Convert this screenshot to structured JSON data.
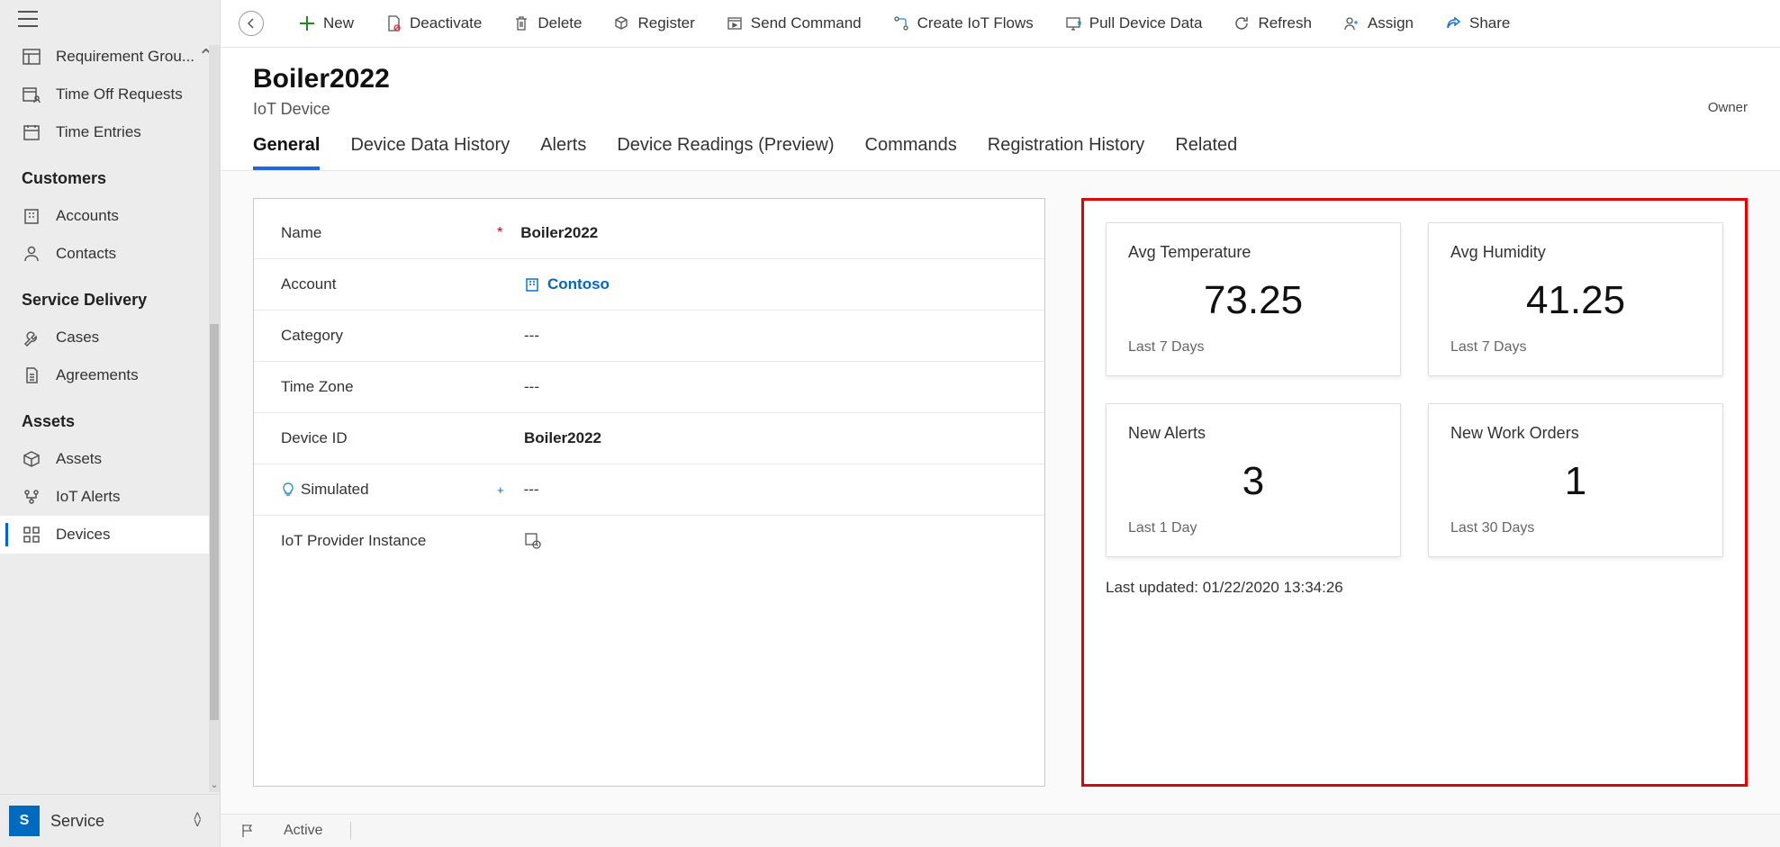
{
  "sidebar": {
    "items_top": [
      {
        "label": "Requirement Grou...",
        "icon": "layout"
      },
      {
        "label": "Time Off Requests",
        "icon": "calendar-person"
      },
      {
        "label": "Time Entries",
        "icon": "calendar"
      }
    ],
    "sections": [
      {
        "title": "Customers",
        "items": [
          {
            "label": "Accounts",
            "icon": "building"
          },
          {
            "label": "Contacts",
            "icon": "person"
          }
        ]
      },
      {
        "title": "Service Delivery",
        "items": [
          {
            "label": "Cases",
            "icon": "wrench"
          },
          {
            "label": "Agreements",
            "icon": "document"
          }
        ]
      },
      {
        "title": "Assets",
        "items": [
          {
            "label": "Assets",
            "icon": "cube"
          },
          {
            "label": "IoT Alerts",
            "icon": "alert-net"
          },
          {
            "label": "Devices",
            "icon": "grid",
            "active": true
          }
        ]
      }
    ],
    "footer": {
      "badge": "S",
      "label": "Service"
    }
  },
  "commands": [
    {
      "label": "New",
      "icon": "plus",
      "color": "#1a8f1a"
    },
    {
      "label": "Deactivate",
      "icon": "doc-cancel"
    },
    {
      "label": "Delete",
      "icon": "trash"
    },
    {
      "label": "Register",
      "icon": "cube-out"
    },
    {
      "label": "Send Command",
      "icon": "window-play"
    },
    {
      "label": "Create IoT Flows",
      "icon": "flow"
    },
    {
      "label": "Pull Device Data",
      "icon": "monitor-down"
    },
    {
      "label": "Refresh",
      "icon": "refresh"
    },
    {
      "label": "Assign",
      "icon": "person-plus"
    },
    {
      "label": "Share",
      "icon": "share",
      "color": "#1a6fd6"
    }
  ],
  "header": {
    "title": "Boiler2022",
    "subtitle": "IoT Device",
    "owner_label": "Owner"
  },
  "tabs": [
    {
      "label": "General",
      "active": true
    },
    {
      "label": "Device Data History"
    },
    {
      "label": "Alerts"
    },
    {
      "label": "Device Readings (Preview)"
    },
    {
      "label": "Commands"
    },
    {
      "label": "Registration History"
    },
    {
      "label": "Related"
    }
  ],
  "form": {
    "rows": [
      {
        "label": "Name",
        "required": true,
        "value": "Boiler2022",
        "type": "text"
      },
      {
        "label": "Account",
        "value": "Contoso",
        "type": "link"
      },
      {
        "label": "Category",
        "value": "---",
        "type": "empty"
      },
      {
        "label": "Time Zone",
        "value": "---",
        "type": "empty"
      },
      {
        "label": "Device ID",
        "value": "Boiler2022",
        "type": "text"
      },
      {
        "label": "Simulated",
        "value": "---",
        "type": "empty",
        "hint": true,
        "plus": true
      },
      {
        "label": "IoT Provider Instance",
        "value": "",
        "type": "iconval"
      }
    ]
  },
  "cards": [
    {
      "title": "Avg Temperature",
      "value": "73.25",
      "sub": "Last 7 Days"
    },
    {
      "title": "Avg Humidity",
      "value": "41.25",
      "sub": "Last 7 Days"
    },
    {
      "title": "New Alerts",
      "value": "3",
      "sub": "Last 1 Day"
    },
    {
      "title": "New Work Orders",
      "value": "1",
      "sub": "Last 30 Days"
    }
  ],
  "last_updated": "Last updated: 01/22/2020 13:34:26",
  "status": {
    "state": "Active"
  }
}
